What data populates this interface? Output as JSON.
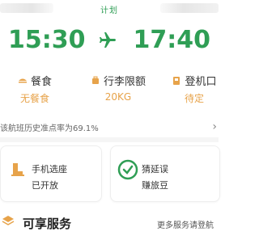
{
  "header": {
    "status_label": "计划"
  },
  "flight": {
    "departure_time": "15:30",
    "arrival_time": "17:40"
  },
  "services": {
    "meal": {
      "title": "餐食",
      "value": "无餐食"
    },
    "baggage": {
      "title": "行李限额",
      "value": "20KG"
    },
    "gate": {
      "title": "登机口",
      "value": "待定"
    }
  },
  "ontime": {
    "text": "该航班历史准点率为69.1%"
  },
  "cards": {
    "seat": {
      "title": "手机选座",
      "subtitle": "已开放"
    },
    "guess": {
      "title": "猜延误",
      "subtitle": "赚旅豆"
    }
  },
  "enjoy": {
    "title": "可享服务",
    "more": "更多服务请登航"
  },
  "colors": {
    "accent_green": "#2f9e55",
    "accent_orange": "#e7a34a"
  }
}
